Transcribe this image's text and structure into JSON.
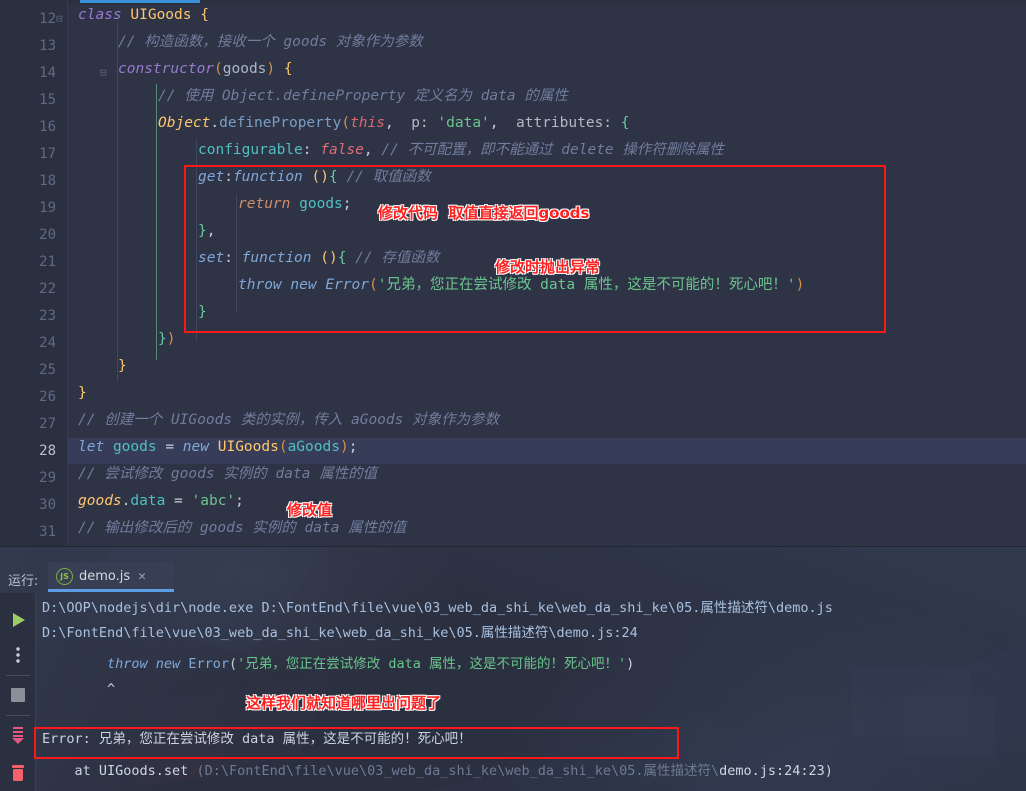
{
  "editor": {
    "tab_indicator": "active-file-tab",
    "current_line": 28,
    "lines": [
      {
        "n": "12",
        "text": "class UIGoods {"
      },
      {
        "n": "13",
        "text": "    // 构造函数，接收一个 goods 对象作为参数"
      },
      {
        "n": "14",
        "text": "    constructor(goods) {"
      },
      {
        "n": "15",
        "text": "        // 使用 Object.defineProperty 定义名为 data 的属性"
      },
      {
        "n": "16",
        "text": "        Object.defineProperty(this,  p: 'data',  attributes: {"
      },
      {
        "n": "17",
        "text": "            configurable: false, // 不可配置，即不能通过 delete 操作符删除属性"
      },
      {
        "n": "18",
        "text": "            get:function (){ // 取值函数"
      },
      {
        "n": "19",
        "text": "                return goods;"
      },
      {
        "n": "20",
        "text": "            },"
      },
      {
        "n": "21",
        "text": "            set: function (){ // 存值函数"
      },
      {
        "n": "22",
        "text": "                throw new Error('兄弟，您正在尝试修改 data 属性，这是不可能的！死心吧！')"
      },
      {
        "n": "23",
        "text": "            }"
      },
      {
        "n": "24",
        "text": "        })"
      },
      {
        "n": "25",
        "text": "    }"
      },
      {
        "n": "26",
        "text": "}"
      },
      {
        "n": "27",
        "text": "// 创建一个 UIGoods 类的实例，传入 aGoods 对象作为参数"
      },
      {
        "n": "28",
        "text": "let goods = new UIGoods(aGoods);"
      },
      {
        "n": "29",
        "text": "// 尝试修改 goods 实例的 data 属性的值"
      },
      {
        "n": "30",
        "text": "goods.data = 'abc';"
      },
      {
        "n": "31",
        "text": "// 输出修改后的 goods 实例的 data 属性的值"
      }
    ],
    "annotations": [
      {
        "id": "annot-modify-code",
        "text": "修改代码  取值直接返回goods",
        "color": "#ff2020"
      },
      {
        "id": "annot-throw-on-set",
        "text": "修改时抛出异常",
        "color": "#ff2020"
      },
      {
        "id": "annot-modify-value",
        "text": "修改值",
        "color": "#ff2020"
      }
    ],
    "highlight_box_color": "#fa1818"
  },
  "console": {
    "run_label": "运行:",
    "tab": {
      "icon": "nodejs-icon",
      "label": "demo.js",
      "close": "✕"
    },
    "toolbar": {
      "rerun": "rerun-button",
      "more": "more-options-button",
      "stop": "stop-button",
      "scroll_to_end": "scroll-to-end-button",
      "trash": "clear-all-button"
    },
    "output": [
      {
        "id": "cmd",
        "text": "D:\\OOP\\nodejs\\dir\\node.exe D:\\FontEnd\\file\\vue\\03_web_da_shi_ke\\web_da_shi_ke\\05.属性描述符\\demo.js"
      },
      {
        "id": "stack-path",
        "text": "D:\\FontEnd\\file\\vue\\03_web_da_shi_ke\\web_da_shi_ke\\05.属性描述符\\demo.js:24"
      },
      {
        "id": "source-line",
        "text": "        throw new Error('兄弟，您正在尝试修改 data 属性，这是不可能的！死心吧！')"
      },
      {
        "id": "caret",
        "text": "        ^"
      },
      {
        "id": "error-line",
        "text": "Error: 兄弟，您正在尝试修改 data 属性，这是不可能的！死心吧！"
      },
      {
        "id": "at-line-fn",
        "text": "    at UIGoods.set "
      },
      {
        "id": "at-line-path",
        "text": "(D:\\FontEnd\\file\\vue\\03_web_da_shi_ke\\web_da_shi_ke\\05.属性描述符\\"
      },
      {
        "id": "at-line-loc",
        "text": "demo.js:24:23)"
      }
    ],
    "annotation": {
      "id": "annot-know-problem",
      "text": "这样我们就知道哪里出问题了",
      "color": "#ff2020"
    },
    "highlight_box_color": "#fa1818"
  }
}
